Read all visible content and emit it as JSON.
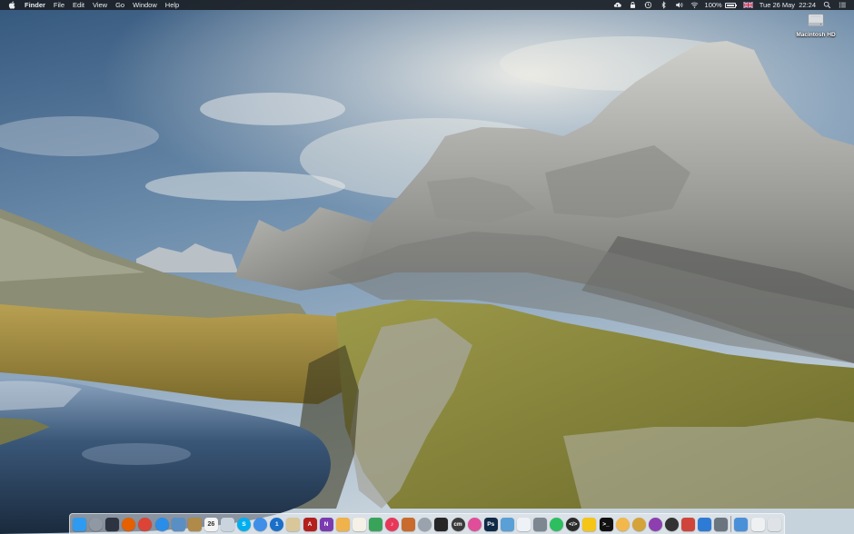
{
  "menubar": {
    "apple_icon": "apple-icon",
    "app_name": "Finder",
    "menus": [
      "File",
      "Edit",
      "View",
      "Go",
      "Window",
      "Help"
    ],
    "status": {
      "icons": [
        "cloud-upload-icon",
        "lock-icon",
        "time-machine-icon",
        "bluetooth-icon",
        "volume-icon",
        "wifi-icon"
      ],
      "battery_percent_text": "100%",
      "battery_level": 1.0,
      "input_source": "flag-uk-icon",
      "clock": "Tue 26 May  22:24",
      "spotlight_icon": "search-icon",
      "notifications_icon": "list-icon"
    }
  },
  "desktop": {
    "icons": [
      {
        "name": "macintosh-hd-icon",
        "label": "Macintosh HD"
      }
    ]
  },
  "dock": {
    "apps": [
      {
        "id": "finder",
        "icon": "finder-icon",
        "glyph": "",
        "bg": "#2f9bf0",
        "shape": "square"
      },
      {
        "id": "launchpad",
        "icon": "launchpad-icon",
        "glyph": "",
        "bg": "#8f98a3",
        "shape": "round"
      },
      {
        "id": "mission-control",
        "icon": "mission-control-icon",
        "glyph": "",
        "bg": "#2d3340",
        "shape": "square"
      },
      {
        "id": "firefox",
        "icon": "firefox-icon",
        "glyph": "",
        "bg": "#e66000",
        "shape": "round"
      },
      {
        "id": "chrome",
        "icon": "chrome-icon",
        "glyph": "",
        "bg": "#db4437",
        "shape": "round"
      },
      {
        "id": "safari",
        "icon": "safari-icon",
        "glyph": "",
        "bg": "#2a8ee8",
        "shape": "round"
      },
      {
        "id": "preview",
        "icon": "preview-icon",
        "glyph": "",
        "bg": "#5a8fc4",
        "shape": "square"
      },
      {
        "id": "notes-app",
        "icon": "notebook-icon",
        "glyph": "",
        "bg": "#b08a48",
        "shape": "square"
      },
      {
        "id": "calendar",
        "icon": "calendar-icon",
        "glyph": "26",
        "bg": "#f4f4f4",
        "shape": "square"
      },
      {
        "id": "photos-viewer",
        "icon": "image-icon",
        "glyph": "",
        "bg": "#c9d4de",
        "shape": "square"
      },
      {
        "id": "skype",
        "icon": "skype-icon",
        "glyph": "S",
        "bg": "#00aff0",
        "shape": "round"
      },
      {
        "id": "messages",
        "icon": "speech-bubble-icon",
        "glyph": "",
        "bg": "#3f8fe8",
        "shape": "round"
      },
      {
        "id": "1password",
        "icon": "keyhole-icon",
        "glyph": "1",
        "bg": "#1a6fc9",
        "shape": "round"
      },
      {
        "id": "mail-stamp",
        "icon": "envelope-icon",
        "glyph": "",
        "bg": "#d9c79a",
        "shape": "square"
      },
      {
        "id": "acrobat",
        "icon": "acrobat-icon",
        "glyph": "A",
        "bg": "#b3201b",
        "shape": "square"
      },
      {
        "id": "onenote",
        "icon": "onenote-icon",
        "glyph": "N",
        "bg": "#7b3bb0",
        "shape": "square"
      },
      {
        "id": "tes",
        "icon": "butterfly-icon",
        "glyph": "",
        "bg": "#f0b24a",
        "shape": "square"
      },
      {
        "id": "text-editor",
        "icon": "document-icon",
        "glyph": "",
        "bg": "#f5f1e6",
        "shape": "square"
      },
      {
        "id": "numbers",
        "icon": "bar-chart-icon",
        "glyph": "",
        "bg": "#3aa35a",
        "shape": "square"
      },
      {
        "id": "itunes",
        "icon": "music-note-icon",
        "glyph": "♪",
        "bg": "#e8385a",
        "shape": "round"
      },
      {
        "id": "utility",
        "icon": "tools-icon",
        "glyph": "",
        "bg": "#c96b2c",
        "shape": "square"
      },
      {
        "id": "disk-utility",
        "icon": "disk-icon",
        "glyph": "",
        "bg": "#9aa3ad",
        "shape": "round"
      },
      {
        "id": "clapper",
        "icon": "clapperboard-icon",
        "glyph": "",
        "bg": "#262626",
        "shape": "square"
      },
      {
        "id": "cmd",
        "icon": "cmd-icon",
        "glyph": "cm",
        "bg": "#3b3b3b",
        "shape": "round"
      },
      {
        "id": "color-picker",
        "icon": "color-wheel-icon",
        "glyph": "",
        "bg": "#e04e9a",
        "shape": "round"
      },
      {
        "id": "photoshop",
        "icon": "photoshop-icon",
        "glyph": "Ps",
        "bg": "#0f2a47",
        "shape": "square"
      },
      {
        "id": "script-editor",
        "icon": "pencil-icon",
        "glyph": "",
        "bg": "#5aa0d6",
        "shape": "square"
      },
      {
        "id": "textedit",
        "icon": "page-icon",
        "glyph": "",
        "bg": "#eef2f6",
        "shape": "square"
      },
      {
        "id": "system-prefs",
        "icon": "gear-icon",
        "glyph": "",
        "bg": "#7d8791",
        "shape": "square"
      },
      {
        "id": "evernote",
        "icon": "leaf-icon",
        "glyph": "",
        "bg": "#2dbe60",
        "shape": "round"
      },
      {
        "id": "coda",
        "icon": "code-brackets-icon",
        "glyph": "</>",
        "bg": "#2b2b2b",
        "shape": "round"
      },
      {
        "id": "cyberduck",
        "icon": "duck-icon",
        "glyph": "",
        "bg": "#f5c518",
        "shape": "square"
      },
      {
        "id": "terminal",
        "icon": "terminal-icon",
        "glyph": ">_",
        "bg": "#111111",
        "shape": "square"
      },
      {
        "id": "transmit",
        "icon": "transmit-icon",
        "glyph": "",
        "bg": "#f2b84b",
        "shape": "round"
      },
      {
        "id": "stacks",
        "icon": "coin-stack-icon",
        "glyph": "",
        "bg": "#d4a43a",
        "shape": "round"
      },
      {
        "id": "podcast",
        "icon": "podcast-icon",
        "glyph": "",
        "bg": "#8d3fb0",
        "shape": "round"
      },
      {
        "id": "github",
        "icon": "github-icon",
        "glyph": "",
        "bg": "#333333",
        "shape": "round"
      },
      {
        "id": "screen-sharing",
        "icon": "screens-icon",
        "glyph": "",
        "bg": "#d0453b",
        "shape": "square"
      },
      {
        "id": "xcode",
        "icon": "hammer-icon",
        "glyph": "",
        "bg": "#2e7bd6",
        "shape": "square"
      },
      {
        "id": "keyboard",
        "icon": "keyboard-icon",
        "glyph": "",
        "bg": "#6b7580",
        "shape": "square"
      },
      {
        "id": "sep",
        "icon": "",
        "glyph": "",
        "bg": "",
        "shape": "separator"
      },
      {
        "id": "downloads",
        "icon": "downloads-stack-icon",
        "glyph": "",
        "bg": "#4a90d9",
        "shape": "square"
      },
      {
        "id": "documents",
        "icon": "documents-stack-icon",
        "glyph": "",
        "bg": "#eef0f2",
        "shape": "square"
      },
      {
        "id": "trash",
        "icon": "trash-icon",
        "glyph": "",
        "bg": "#dfe3e7",
        "shape": "square"
      }
    ]
  }
}
